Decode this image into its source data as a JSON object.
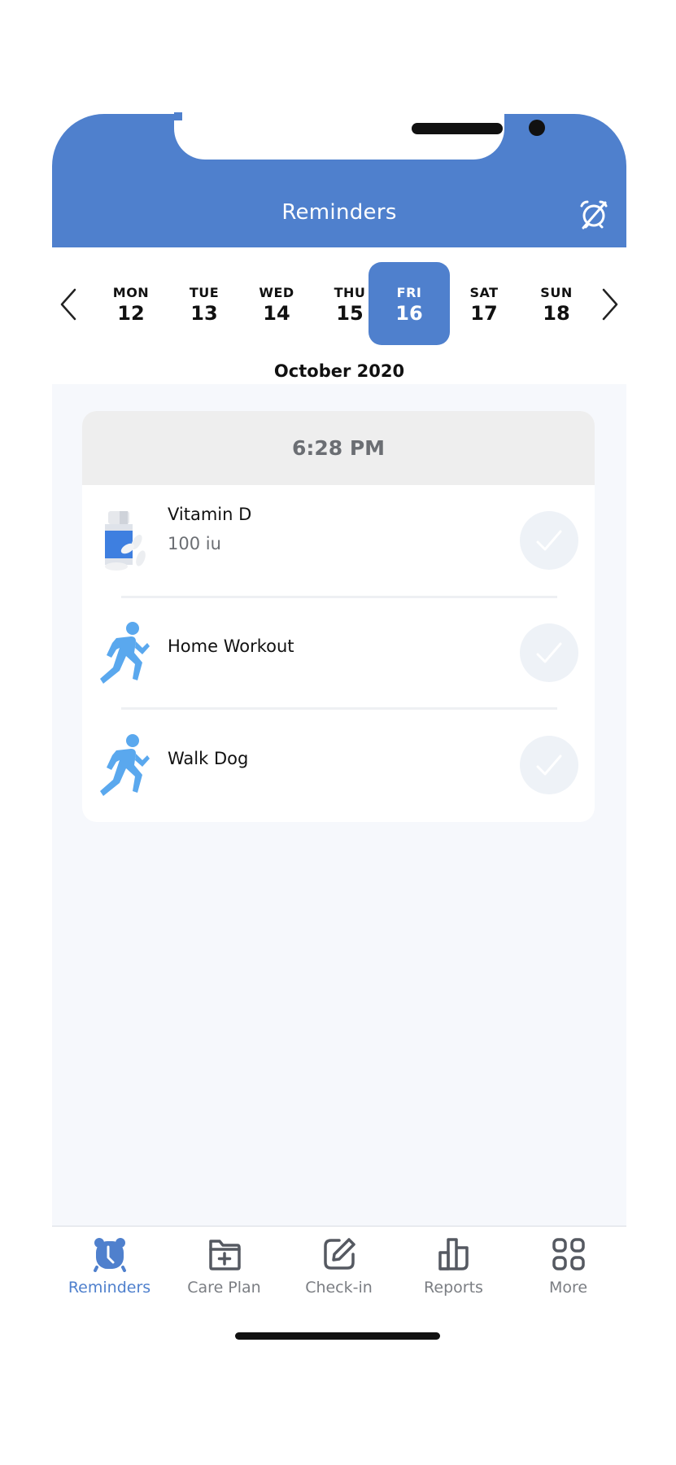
{
  "header": {
    "title": "Reminders",
    "right_icon": "alarm-off-icon"
  },
  "colors": {
    "brand": "#4f80cd",
    "running_icon": "#5aa8ee",
    "background": "#f6f8fc",
    "card_header": "#eeeeee",
    "inactive_tab": "#7b7e83"
  },
  "calendar": {
    "prev_icon": "chevron-left-icon",
    "next_icon": "chevron-right-icon",
    "days": [
      {
        "name": "MON",
        "num": "12",
        "selected": false
      },
      {
        "name": "TUE",
        "num": "13",
        "selected": false
      },
      {
        "name": "WED",
        "num": "14",
        "selected": false
      },
      {
        "name": "THU",
        "num": "15",
        "selected": false
      },
      {
        "name": "FRI",
        "num": "16",
        "selected": true
      },
      {
        "name": "SAT",
        "num": "17",
        "selected": false
      },
      {
        "name": "SUN",
        "num": "18",
        "selected": false
      }
    ],
    "month": "October 2020"
  },
  "reminders": {
    "time": "6:28 PM",
    "items": [
      {
        "title": "Vitamin D",
        "subtitle": "100 iu",
        "icon": "pill-bottle-icon",
        "done": false
      },
      {
        "title": "Home Workout",
        "subtitle": "",
        "icon": "running-person-icon",
        "done": false
      },
      {
        "title": "Walk Dog",
        "subtitle": "",
        "icon": "running-person-icon",
        "done": false
      }
    ]
  },
  "tabbar": {
    "tabs": [
      {
        "label": "Reminders",
        "icon": "alarm-clock-icon",
        "active": true
      },
      {
        "label": "Care Plan",
        "icon": "folder-plus-icon",
        "active": false
      },
      {
        "label": "Check-in",
        "icon": "edit-square-icon",
        "active": false
      },
      {
        "label": "Reports",
        "icon": "bar-chart-icon",
        "active": false
      },
      {
        "label": "More",
        "icon": "grid-icon",
        "active": false
      }
    ]
  }
}
